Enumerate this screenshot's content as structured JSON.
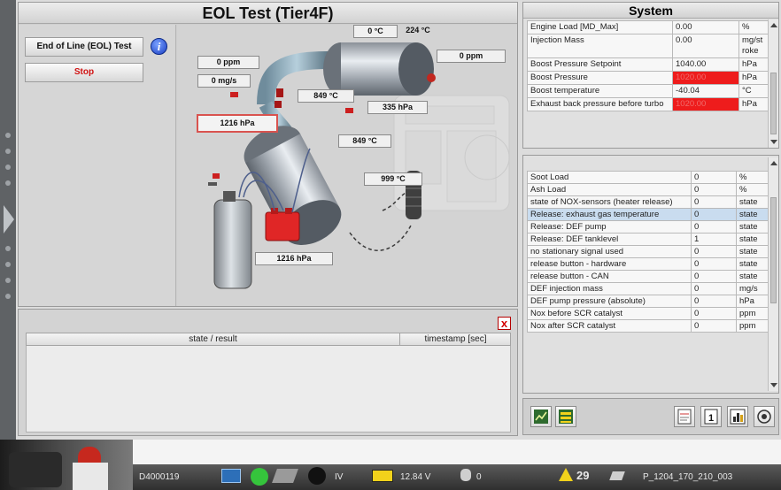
{
  "eol": {
    "title": "EOL Test (Tier4F)",
    "eol_button": "End of Line (EOL) Test",
    "stop_button": "Stop",
    "info_glyph": "i",
    "values": {
      "temp_top_left": "0 °C",
      "temp_top_right": "224 °C",
      "ppm_left": "0 ppm",
      "ppm_right": "0 ppm",
      "mass_flow": "0 mg/s",
      "pressure_boxed": "1216 hPa",
      "temp_mid": "849 °C",
      "pressure_mid": "335 hPa",
      "temp_mid2": "849 °C",
      "temp_low": "999 °C",
      "pressure_bottom": "1216 hPa"
    }
  },
  "results": {
    "close_glyph": "x",
    "col_state": "state / result",
    "col_timestamp": "timestamp [sec]"
  },
  "system": {
    "title": "System",
    "rows": [
      {
        "label": "Engine Load [MD_Max]",
        "value": "0.00",
        "unit": "%",
        "alarm": false
      },
      {
        "label": "Injection Mass",
        "value": "0.00",
        "unit": "mg/st roke",
        "alarm": false
      },
      {
        "label": "Boost Pressure Setpoint",
        "value": "1040.00",
        "unit": "hPa",
        "alarm": false
      },
      {
        "label": "Boost Pressure",
        "value": "1020.00",
        "unit": "hPa",
        "alarm": true
      },
      {
        "label": "Boost temperature",
        "value": "-40.04",
        "unit": "°C",
        "alarm": false
      },
      {
        "label": "Exhaust back pressure before turbo",
        "value": "1020.00",
        "unit": "hPa",
        "alarm": true
      }
    ]
  },
  "status": {
    "rows": [
      {
        "label": "Soot Load",
        "value": "0",
        "unit": "%"
      },
      {
        "label": "Ash Load",
        "value": "0",
        "unit": "%"
      },
      {
        "label": "state of NOX-sensors (heater release)",
        "value": "0",
        "unit": "state"
      },
      {
        "label": "Release: exhaust gas temperature",
        "value": "0",
        "unit": "state",
        "selected": true
      },
      {
        "label": "Release: DEF pump",
        "value": "0",
        "unit": "state"
      },
      {
        "label": "Release: DEF tanklevel",
        "value": "1",
        "unit": "state"
      },
      {
        "label": "no stationary signal used",
        "value": "0",
        "unit": "state"
      },
      {
        "label": "release button - hardware",
        "value": "0",
        "unit": "state"
      },
      {
        "label": "release button - CAN",
        "value": "0",
        "unit": "state"
      },
      {
        "label": "DEF injection mass",
        "value": "0",
        "unit": "mg/s"
      },
      {
        "label": "DEF pump pressure (absolute)",
        "value": "0",
        "unit": "hPa"
      },
      {
        "label": "Nox before SCR catalyst",
        "value": "0",
        "unit": "ppm"
      },
      {
        "label": "Nox after SCR catalyst",
        "value": "0",
        "unit": "ppm"
      }
    ]
  },
  "toolbar": {
    "icons": [
      "graph-icon",
      "list-icon",
      "report-icon",
      "counter-icon",
      "bar-chart-icon",
      "settings-icon"
    ]
  },
  "statusbar": {
    "device_id": "D4000119",
    "level": "IV",
    "voltage": "12.84 V",
    "count": "0",
    "warnings": "29",
    "project": "P_1204_170_210_003"
  },
  "colors": {
    "alarm": "#ee1c1c",
    "selected_row": "#c9dcef",
    "stop_text": "#d01212",
    "status_ok": "#35c43c"
  }
}
